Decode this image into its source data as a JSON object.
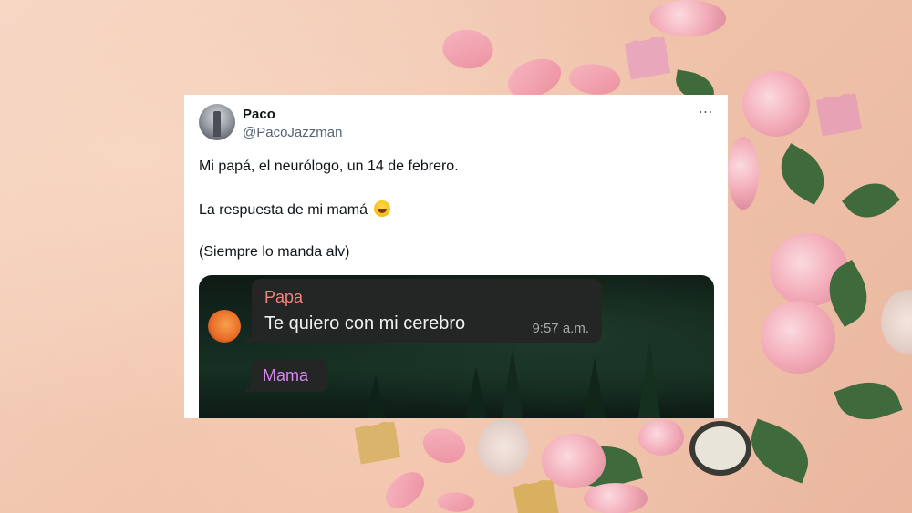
{
  "tweet": {
    "author_name": "Paco",
    "author_handle": "@PacoJazzman",
    "more_icon": "⋯",
    "lines": [
      "Mi papá, el neurólogo, un 14 de febrero.",
      "La respuesta de mi mamá",
      "(Siempre lo manda alv)"
    ],
    "emoji": "rolling-on-floor-laughing-emoji"
  },
  "chat": {
    "message1": {
      "sender": "Papa",
      "text": "Te quiero con mi cerebro",
      "time": "9:57 a.m."
    },
    "message2": {
      "sender": "Mama"
    }
  },
  "colors": {
    "papa_name": "#f2847b",
    "mama_name": "#d489f0",
    "bubble": "#232625"
  }
}
